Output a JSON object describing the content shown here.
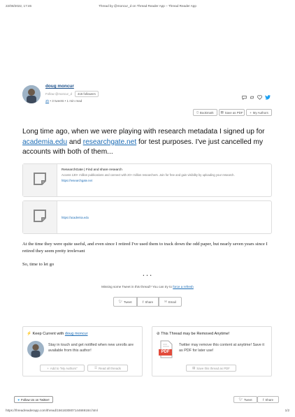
{
  "print_header": {
    "date": "22/08/2022, 17:46",
    "title": "Thread by @moncur_d on Thread Reader App – Thread Reader App"
  },
  "author": {
    "name": "doug moncur",
    "follow_text": "Follow @moncur_d",
    "followers": "415 followers",
    "meta_prefix": "2h",
    "meta_rest": "• 3 tweets • 1 min read"
  },
  "actions": {
    "bookmark": "Bookmark",
    "save_pdf": "Save as PDF",
    "my_authors": "My Authors"
  },
  "tweet1": {
    "text_a": "Long time ago, when we were playing with research metadata I signed up for",
    "link1": "academia.edu",
    "text_b": "and",
    "link2": "researchgate.net",
    "text_c": "for test purposes. I've just cancelled my accounts with both of them..."
  },
  "card1": {
    "title": "ResearchGate | Find and share research",
    "desc": "Access 130+ million publications and connect with 20+ million researchers. Join for free and gain visibility by uploading your research.",
    "url": "https://researchgate.net"
  },
  "card2": {
    "url": "https://academia.edu"
  },
  "tweet2": "At the time they were quite useful, and even since I retired I've used them to track down the odd paper, but nearly seven years since I retired they seem pretty irrelevant",
  "tweet3": "So, time to let go",
  "separator": "• • •",
  "missing": {
    "text": "Missing some Tweet in this thread? You can try to",
    "link": "force a refresh"
  },
  "share": {
    "tweet": "Tweet",
    "share": "Share",
    "email": "Email"
  },
  "keep_current": {
    "title_prefix": "Keep Current with",
    "title_link": "doug moncur",
    "body": "Stay in touch and get notified when new unrolls are available from this author!",
    "add_btn": "Add to \"My Authors\"",
    "read_btn": "Read all threads"
  },
  "removed": {
    "title": "This Thread may be Removed Anytime!",
    "pdf_label": "PDF",
    "body": "Twitter may remove this content at anytime! Save it as PDF for later use!",
    "save_btn": "Save this thread as PDF"
  },
  "bottom": {
    "follow": "Follow Us on Twitter!",
    "tweet": "Tweet",
    "share": "Share"
  },
  "print_footer": {
    "url": "https://threadreaderapp.com/thread/1561830807144669184.html",
    "page": "1/2"
  },
  "colors": {
    "link": "#1a6bb5",
    "twitter": "#1da1f2",
    "pdf": "#e24b3b"
  }
}
